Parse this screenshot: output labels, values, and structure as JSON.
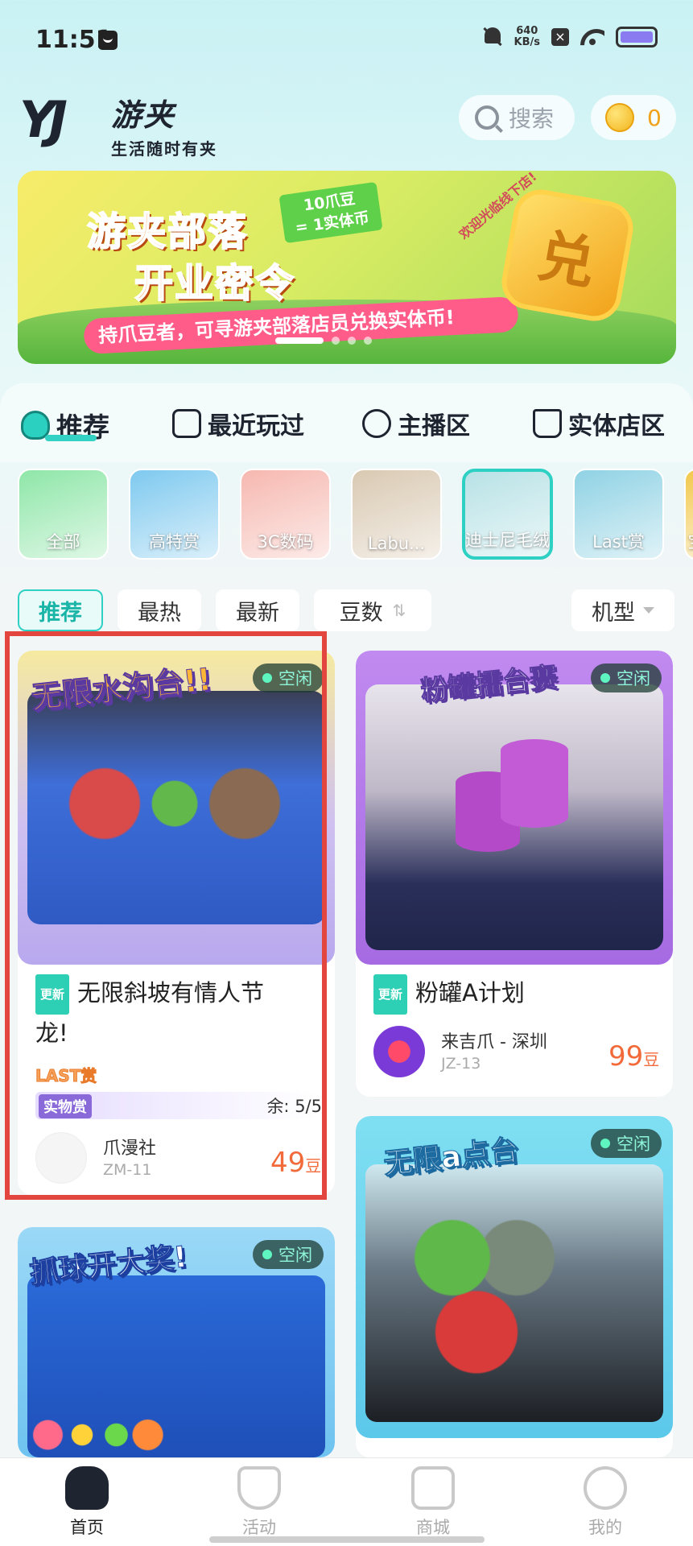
{
  "status_bar": {
    "time": "11:51",
    "net_speed_value": "640",
    "net_speed_unit": "KB/s"
  },
  "header": {
    "logo_mark": "YJ",
    "app_name": "游夹",
    "slogan": "生活随时有夹",
    "search_placeholder": "搜索",
    "coin_count": "0"
  },
  "banner": {
    "title_line1": "游夹部落",
    "title_line2": "开业密令",
    "tag_line1": "10爪豆",
    "tag_line2": "= 1实体币",
    "ribbon": "持爪豆者，可寻游夹部落店员兑换实体币!",
    "side_text": "欢迎光临线下店!",
    "badge": "兑",
    "active_slide": 1,
    "slide_count": 5
  },
  "tabs": [
    {
      "label": "推荐",
      "icon": "flame-top-icon",
      "active": true
    },
    {
      "label": "最近玩过",
      "icon": "pentagon-icon",
      "active": false
    },
    {
      "label": "主播区",
      "icon": "microphone-icon",
      "active": false
    },
    {
      "label": "实体店区",
      "icon": "cup-icon",
      "active": false
    }
  ],
  "categories": [
    {
      "label": "全部",
      "color": "#8ee6a8"
    },
    {
      "label": "高特赏",
      "color": "#7ec9ef"
    },
    {
      "label": "3C数码",
      "color": "#f6b8b0"
    },
    {
      "label": "Labu...",
      "color": "#d9c9b2"
    },
    {
      "label": "迪士尼毛绒",
      "color": "#b8e2e6"
    },
    {
      "label": "Last赏",
      "color": "#8fd2e4"
    },
    {
      "label": "宝",
      "color": "#f2c84a"
    }
  ],
  "filters": {
    "chips": [
      "推荐",
      "最热",
      "最新",
      "豆数"
    ],
    "active": "推荐",
    "model": "机型"
  },
  "cards": [
    {
      "banner_text": "无限水沟台!!",
      "status": "空闲",
      "is_new": true,
      "new_label": "更新",
      "title_line1": "无限斜坡有情人节",
      "title_line2": "龙!",
      "last_tag": "LAST赏",
      "prize_tag": "实物赏",
      "remaining": "余: 5/5",
      "shop_name": "爪漫社",
      "shop_id": "ZM-11",
      "price": "49",
      "unit": "豆",
      "img_color": "#3e6ed8"
    },
    {
      "banner_text": "粉罐擂台赛",
      "status": "空闲",
      "is_new": true,
      "new_label": "更新",
      "title_line1": "粉罐A计划",
      "shop_name": "来吉爪 - 深圳",
      "shop_id": "JZ-13",
      "price": "99",
      "unit": "豆",
      "img_color": "#b57ae8"
    },
    {
      "banner_text": "抓球开大奖!",
      "status": "空闲",
      "img_color": "#8fd8f5"
    },
    {
      "banner_text": "无限a点台",
      "status": "空闲",
      "img_color": "#7dd8f0"
    }
  ],
  "bottom_nav": [
    {
      "label": "首页",
      "icon": "home-icon",
      "active": true
    },
    {
      "label": "活动",
      "icon": "trophy-icon",
      "active": false
    },
    {
      "label": "商城",
      "icon": "shop-icon",
      "active": false
    },
    {
      "label": "我的",
      "icon": "bear-face-icon",
      "active": false
    }
  ],
  "colors": {
    "accent": "#2fd0c4",
    "price": "#f26a3a",
    "highlight": "#e2463e"
  }
}
